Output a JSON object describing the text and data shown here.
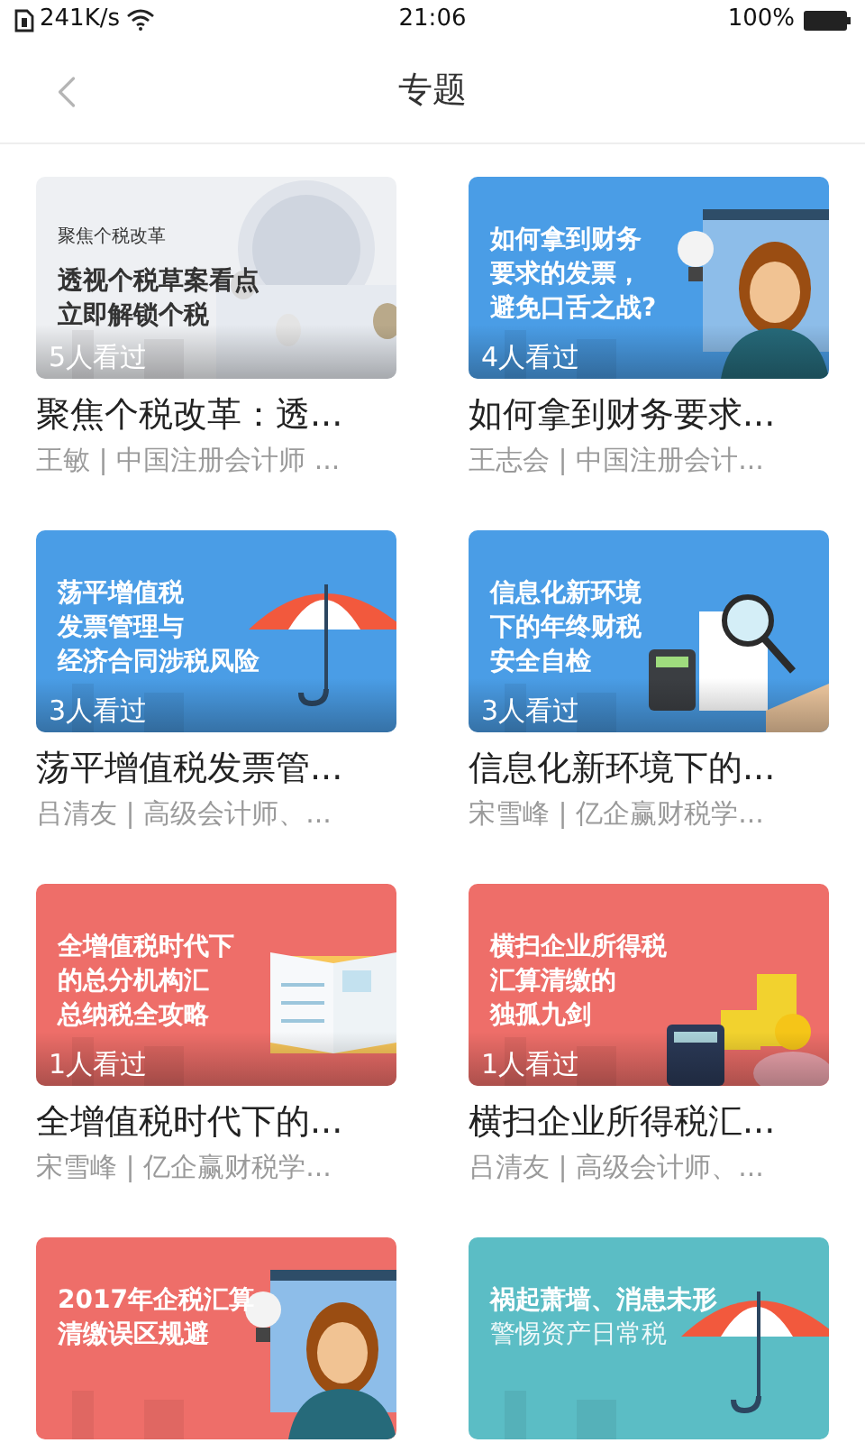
{
  "status_bar": {
    "speed": "241K/s",
    "time": "21:06",
    "battery": "100%"
  },
  "header": {
    "title": "专题"
  },
  "cards": [
    {
      "lines": [
        "聚焦个税改革",
        "透视个税草案看点",
        "立即解锁个税"
      ],
      "views": "5人看过",
      "title": "聚焦个税改革：透...",
      "meta": "王敏 | 中国注册会计师 ..."
    },
    {
      "lines": [
        "如何拿到财务",
        "要求的发票，",
        "避免口舌之战?"
      ],
      "views": "4人看过",
      "title": "如何拿到财务要求...",
      "meta": "王志会 | 中国注册会计..."
    },
    {
      "lines": [
        "荡平增值税",
        "发票管理与",
        "经济合同涉税风险"
      ],
      "views": "3人看过",
      "title": "荡平增值税发票管...",
      "meta": "吕清友 | 高级会计师、..."
    },
    {
      "lines": [
        "信息化新环境",
        "下的年终财税",
        "安全自检"
      ],
      "views": "3人看过",
      "title": "信息化新环境下的...",
      "meta": "宋雪峰 | 亿企赢财税学..."
    },
    {
      "lines": [
        "全增值税时代下",
        "的总分机构汇",
        "总纳税全攻略"
      ],
      "views": "1人看过",
      "title": "全增值税时代下的...",
      "meta": "宋雪峰 | 亿企赢财税学..."
    },
    {
      "lines": [
        "横扫企业所得税",
        "汇算清缴的",
        "独孤九剑"
      ],
      "views": "1人看过",
      "title": "横扫企业所得税汇...",
      "meta": "吕清友 | 高级会计师、..."
    },
    {
      "lines": [
        "2017年企税汇算",
        "清缴误区规避"
      ]
    },
    {
      "lines": [
        "祸起萧墙、消患未形",
        "警惕资产日常税"
      ]
    }
  ]
}
